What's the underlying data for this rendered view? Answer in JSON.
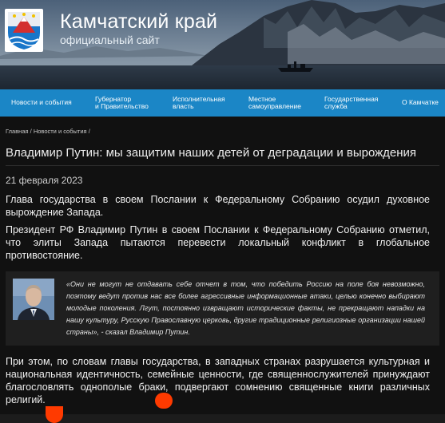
{
  "header": {
    "title": "Камчатский край",
    "subtitle": "официальный сайт"
  },
  "nav": {
    "items": [
      {
        "line1": "Новости и события",
        "line2": ""
      },
      {
        "line1": "Губернатор",
        "line2": "и Правительство"
      },
      {
        "line1": "Исполнительная",
        "line2": "власть"
      },
      {
        "line1": "Местное",
        "line2": "самоуправление"
      },
      {
        "line1": "Государственная",
        "line2": "служба"
      },
      {
        "line1": "О Камчатке",
        "line2": ""
      }
    ]
  },
  "breadcrumb": {
    "items": [
      "Главная",
      "Новости и события"
    ],
    "separator": "/"
  },
  "article": {
    "title": "Владимир Путин: мы защитим наших детей от деградации и вырождения",
    "date": "21 февраля 2023",
    "paragraph1": "Глава государства в своем Послании к Федеральному Собранию осудил духовное вырождение Запада.",
    "paragraph2": "Президент РФ Владимир Путин в своем Послании к Федеральному Собранию отметил, что элиты Запада пытаются перевести локальный конфликт в глобальное противостояние.",
    "quote": "«Они не могут не отдавать себе отчет в том, что победить Россию на поле боя невозможно, поэтому ведут против нас все более агрессивные информационные атаки, целью конечно выбирают молодые поколения. Лгут, постоянно извращают исторические факты, не прекращают нападки на нашу культуру, Русскую Православную церковь, другие традиционные религиозные организации нашей страны», - сказал Владимир Путин.",
    "paragraph3": "При этом, по словам главы государства, в западных странах разрушается культурная и национальная идентичность, семейные ценности, где священнослужителей принуждают благословлять однополые браки, подвергают сомнению священные книги различных религий."
  },
  "colors": {
    "nav_bg": "#1b86c6",
    "page_bg": "#111111",
    "accent_blob": "#ff3a00"
  }
}
